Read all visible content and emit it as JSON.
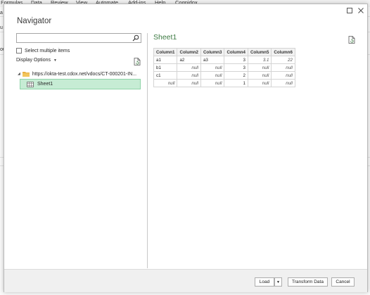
{
  "background": {
    "menu_items": [
      "Formulas",
      "Data",
      "Review",
      "View",
      "Automate",
      "Add-ins",
      "Help",
      "Cognidox"
    ],
    "left_edge_letters": [
      "a",
      "u",
      "ou"
    ]
  },
  "dialog": {
    "title": "Navigator",
    "window_buttons": [
      "maximize-icon",
      "close-icon"
    ]
  },
  "left_pane": {
    "search": {
      "value": "",
      "placeholder": ""
    },
    "select_multiple_label": "Select multiple items",
    "select_multiple_checked": false,
    "display_options_label": "Display Options",
    "tree": {
      "source_label": "https://okta-test.cdox.net/vdocs/CT-000201-IN...",
      "items": [
        {
          "label": "Sheet1",
          "selected": true
        }
      ]
    }
  },
  "right_pane": {
    "preview_title": "Sheet1",
    "table": {
      "columns": [
        "Column1",
        "Column2",
        "Column3",
        "Column4",
        "Column5",
        "Column6"
      ],
      "rows": [
        [
          "a1",
          "a2",
          "a3",
          "3",
          "3.1",
          "22"
        ],
        [
          "b1",
          "null",
          "null",
          "3",
          "null",
          "null"
        ],
        [
          "c1",
          "null",
          "null",
          "2",
          "null",
          "null"
        ],
        [
          "null",
          "null",
          "null",
          "1",
          "null",
          "null"
        ]
      ]
    }
  },
  "footer": {
    "load_label": "Load",
    "transform_label": "Transform Data",
    "cancel_label": "Cancel"
  },
  "colors": {
    "selection_fill": "#c6ecd4",
    "selection_border": "#8fd4a8",
    "preview_title": "#3d7a43",
    "folder": "#e8b042"
  }
}
